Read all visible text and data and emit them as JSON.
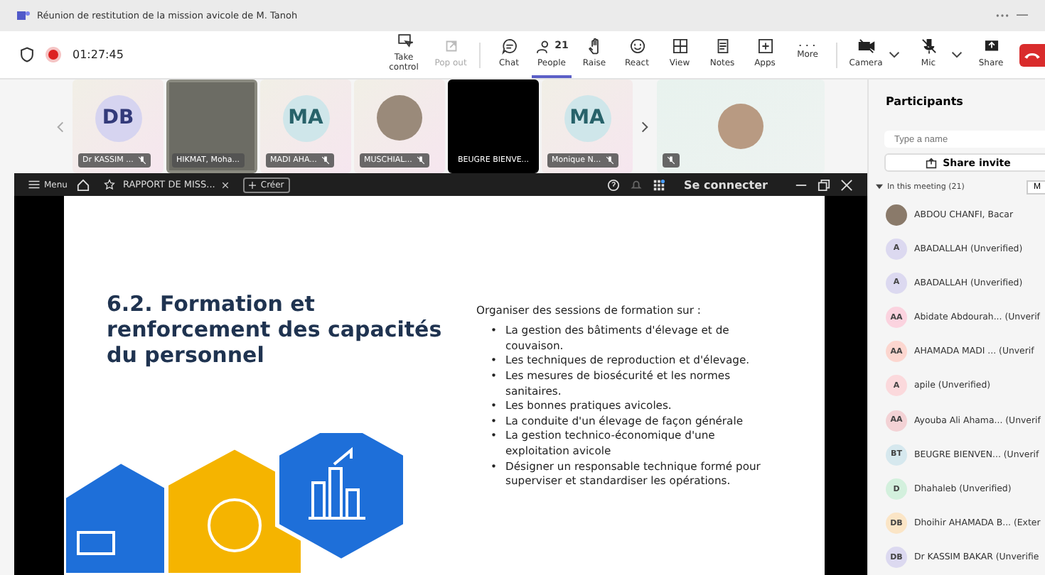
{
  "window": {
    "title": "Réunion de restitution de la mission avicole de M. Tanoh"
  },
  "call": {
    "recording": true,
    "elapsed": "01:27:45"
  },
  "toolbar": [
    {
      "label": "Take control",
      "disabled": false,
      "selected": false
    },
    {
      "label": "Pop out",
      "disabled": true,
      "selected": false
    },
    {
      "label": "Chat",
      "disabled": false,
      "selected": false
    },
    {
      "label": "People",
      "badge": "21",
      "disabled": false,
      "selected": true
    },
    {
      "label": "Raise",
      "disabled": false,
      "selected": false
    },
    {
      "label": "React",
      "disabled": false,
      "selected": false
    },
    {
      "label": "View",
      "disabled": false,
      "selected": false
    },
    {
      "label": "Notes",
      "disabled": false,
      "selected": false
    },
    {
      "label": "Apps",
      "disabled": false,
      "selected": false
    },
    {
      "label": "More",
      "disabled": false,
      "selected": false
    }
  ],
  "devices": [
    {
      "label": "Camera",
      "on": false
    },
    {
      "label": "Mic",
      "on": false
    }
  ],
  "share": {
    "label": "Share"
  },
  "gallery": [
    {
      "kind": "initials",
      "initials": "DB",
      "name": "Dr KASSIM ...",
      "muted": true
    },
    {
      "kind": "video",
      "name": "HIKMAT, Moha...",
      "muted": false
    },
    {
      "kind": "initials",
      "initials": "MA",
      "name": "MADI AHA...",
      "muted": true
    },
    {
      "kind": "photo",
      "name": "MUSCHIAL...",
      "muted": true
    },
    {
      "kind": "black",
      "name": "BEUGRE BIENVE...",
      "muted": false
    },
    {
      "kind": "initials",
      "initials": "MA",
      "name": "Monique N...",
      "muted": true
    }
  ],
  "featured_tile": {
    "muted": true
  },
  "shared_app": {
    "menu": "Menu",
    "tab": "RAPPORT DE MISS...",
    "new_button": "Créer",
    "sign_in": "Se connecter"
  },
  "slide": {
    "marker": "•",
    "heading": "6.2. Formation et renforcement des capacités du personnel",
    "intro": "Organiser des sessions de formation sur :",
    "bullets": [
      "La gestion des bâtiments d'élevage et de couvaison.",
      "Les techniques de reproduction et d'élevage.",
      "Les mesures de biosécurité et les normes sanitaires.",
      "Les bonnes pratiques avicoles.",
      "La conduite d'un élevage de façon générale",
      "La gestion technico-économique d'une exploitation avicole",
      "Désigner un responsable technique formé pour superviser et standardiser les opérations."
    ]
  },
  "participants": {
    "title": "Participants",
    "search_placeholder": "Type a name",
    "share_invite": "Share invite",
    "section": "In this meeting (21)",
    "expanded": true,
    "section_button": "M",
    "people": [
      {
        "kind": "photo",
        "name": "ABDOU CHANFI, Bacar"
      },
      {
        "kind": "initials",
        "initials": "A",
        "name": "ABADALLAH (Unverified)",
        "color": "#dcd9f0"
      },
      {
        "kind": "initials",
        "initials": "A",
        "name": "ABADALLAH (Unverified)",
        "color": "#dcd9f0"
      },
      {
        "kind": "initials",
        "initials": "AA",
        "name": "Abidate Abdourah... (Unverif",
        "color": "#fbd3df"
      },
      {
        "kind": "initials",
        "initials": "AA",
        "name": "AHAMADA MADI ... (Unverif",
        "color": "#fcd6cf"
      },
      {
        "kind": "initials",
        "initials": "A",
        "name": "apile (Unverified)",
        "color": "#fbd9dc"
      },
      {
        "kind": "initials",
        "initials": "AA",
        "name": "Ayouba Ali Ahama... (Unverif",
        "color": "#f3d2d5"
      },
      {
        "kind": "initials",
        "initials": "BT",
        "name": "BEUGRE BIENVEN... (Unverif",
        "color": "#d6e8ee"
      },
      {
        "kind": "initials",
        "initials": "D",
        "name": "Dhahaleb (Unverified)",
        "color": "#d3f0dd"
      },
      {
        "kind": "initials",
        "initials": "DB",
        "name": "Dhoihir AHAMADA B... (Exter",
        "color": "#fbe5c6"
      },
      {
        "kind": "initials",
        "initials": "DB",
        "name": "Dr KASSIM BAKAR (Unverifie",
        "color": "#dcd9f0"
      }
    ]
  }
}
